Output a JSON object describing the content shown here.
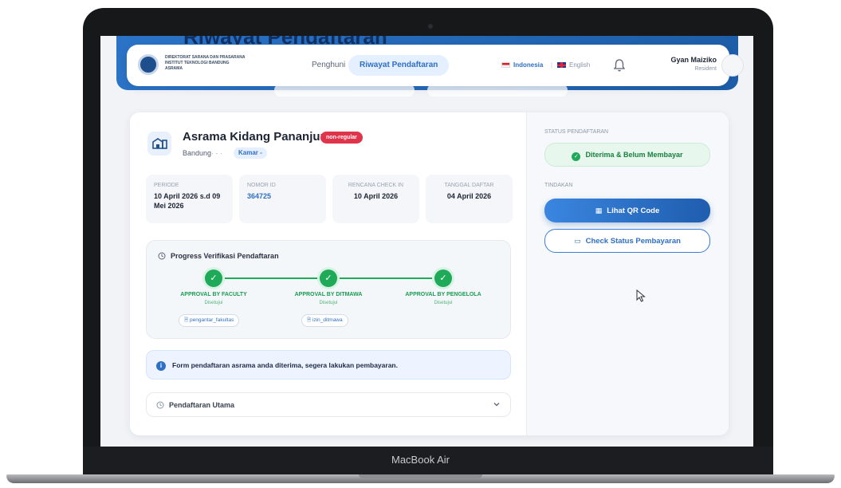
{
  "device": {
    "label": "MacBook Air"
  },
  "background": {
    "title": "Riwayat Pendaftaran"
  },
  "navbar": {
    "org_line1": "DIREKTORAT SARANA DAN PRASARANA",
    "org_line2": "INSTITUT TEKNOLOGI BANDUNG",
    "org_line3": "ASRAMA",
    "tabs": [
      {
        "label": "Penghuni",
        "active": false
      },
      {
        "label": "Riwayat Pendaftaran",
        "active": true
      }
    ],
    "languages": [
      {
        "label": "Indonesia",
        "active": true
      },
      {
        "label": "English",
        "active": false
      }
    ],
    "user": {
      "name": "Gyan Maiziko",
      "role": "Resident"
    }
  },
  "registration": {
    "dorm_name": "Asrama Kidang Pananjung",
    "badge": "non-regular",
    "city": "Bandung",
    "separator": "· - ·",
    "room": "Kamar -",
    "info": [
      {
        "label": "PERIODE",
        "value": "10 April 2026 s.d 09 Mei 2026"
      },
      {
        "label": "NOMOR ID",
        "value": "364725"
      },
      {
        "label": "RENCANA CHECK IN",
        "value": "10 April 2026"
      },
      {
        "label": "TANGGAL DAFTAR",
        "value": "04 April 2026"
      }
    ]
  },
  "progress": {
    "title": "Progress Verifikasi Pendaftaran",
    "steps": [
      {
        "label": "APPROVAL BY FACULTY",
        "status": "Disetujui",
        "file": "pengantar_fakultas"
      },
      {
        "label": "APPROVAL BY DITMAWA",
        "status": "Disetujui",
        "file": "izin_ditmawa"
      },
      {
        "label": "APPROVAL BY PENGELOLA",
        "status": "Disetujui",
        "file": ""
      }
    ]
  },
  "alert": {
    "text": "Form pendaftaran asrama anda diterima, segera lakukan pembayaran."
  },
  "accordion": {
    "label": "Pendaftaran Utama"
  },
  "side": {
    "status_heading": "STATUS PENDAFTARAN",
    "status_text": "Diterima & Belum Membayar",
    "actions_heading": "TINDAKAN",
    "qr_button": "Lihat QR Code",
    "payment_button": "Check Status Pembayaran"
  },
  "colors": {
    "primary": "#2f6fc4",
    "success": "#1faa59",
    "badge": "#e0344a"
  }
}
